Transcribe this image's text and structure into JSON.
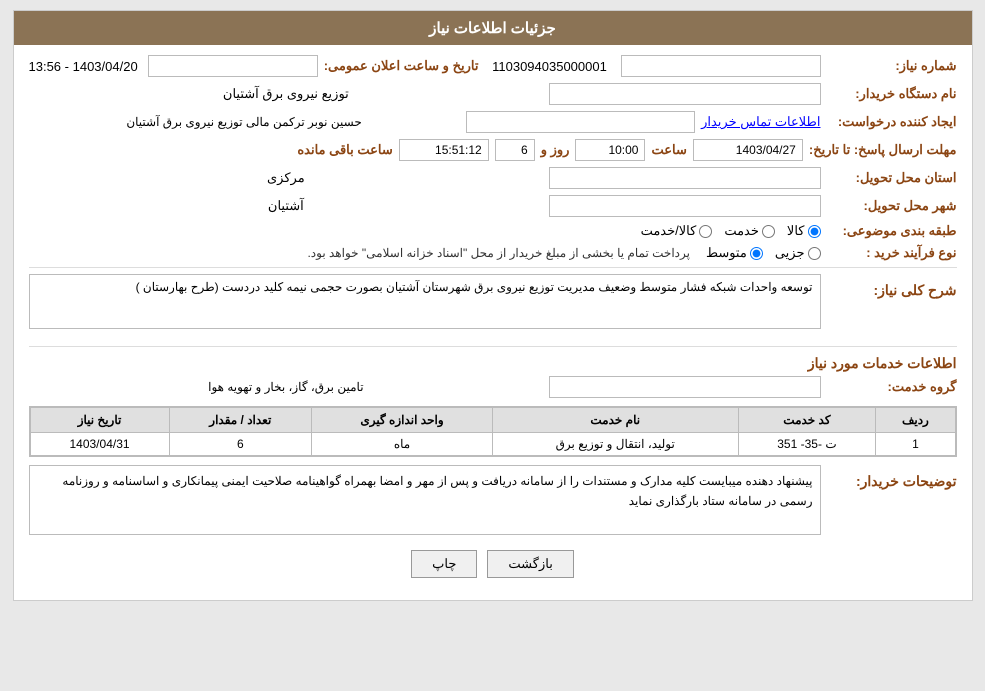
{
  "header": {
    "title": "جزئیات اطلاعات نیاز"
  },
  "fields": {
    "request_number_label": "شماره نیاز:",
    "request_number_value": "1103094035000001",
    "announce_date_label": "تاریخ و ساعت اعلان عمومی:",
    "announce_date_value": "1403/04/20 - 13:56",
    "buyer_org_label": "نام دستگاه خریدار:",
    "buyer_org_value": "توزیع نیروی برق آشتیان",
    "creator_label": "ایجاد کننده درخواست:",
    "creator_value": "حسین نوبر ترکمن  مالی توزیع نیروی برق آشتیان",
    "creator_link": "اطلاعات تماس خریدار",
    "deadline_label": "مهلت ارسال پاسخ: تا تاریخ:",
    "deadline_date": "1403/04/27",
    "deadline_time_label": "ساعت",
    "deadline_time": "10:00",
    "deadline_day_label": "روز و",
    "deadline_days": "6",
    "deadline_remaining_label": "ساعت باقی مانده",
    "deadline_remaining": "15:51:12",
    "province_label": "استان محل تحویل:",
    "province_value": "مرکزی",
    "city_label": "شهر محل تحویل:",
    "city_value": "آشتیان",
    "category_label": "طبقه بندی موضوعی:",
    "category_options": [
      "کالا",
      "خدمت",
      "کالا/خدمت"
    ],
    "category_selected": "کالا",
    "process_label": "نوع فرآیند خرید :",
    "process_options": [
      "جزیی",
      "متوسط"
    ],
    "process_selected": "متوسط",
    "process_note": "پرداخت تمام یا بخشی از مبلغ خریدار از محل \"اسناد خزانه اسلامی\" خواهد بود.",
    "description_section_title": "شرح کلی نیاز:",
    "description_value": "توسعه واحدات شبکه فشار متوسط وضعیف مدیریت توزیع نیروی برق شهرستان آشتیان بصورت حجمی نیمه کلید دردست (طرح بهارستان )",
    "services_section_title": "اطلاعات خدمات مورد نیاز",
    "service_group_label": "گروه خدمت:",
    "service_group_value": "تامین برق، گاز، بخار و تهویه هوا",
    "table": {
      "headers": [
        "ردیف",
        "کد خدمت",
        "نام خدمت",
        "واحد اندازه گیری",
        "تعداد / مقدار",
        "تاریخ نیاز"
      ],
      "rows": [
        {
          "row": "1",
          "code": "ت -35- 351",
          "name": "تولید، انتقال و توزیع برق",
          "unit": "ماه",
          "qty": "6",
          "date": "1403/04/31"
        }
      ]
    },
    "buyer_notes_label": "توضیحات خریدار:",
    "buyer_notes_value": "پیشنهاد دهنده میبایست کلیه مدارک و مستندات را از سامانه دریافت و پس از مهر و امضا بهمراه گواهینامه صلاحیت ایمنی پیمانکاری و اساسنامه و روزنامه رسمی در سامانه ستاد بارگذاری نماید"
  },
  "buttons": {
    "print_label": "چاپ",
    "back_label": "بازگشت"
  }
}
